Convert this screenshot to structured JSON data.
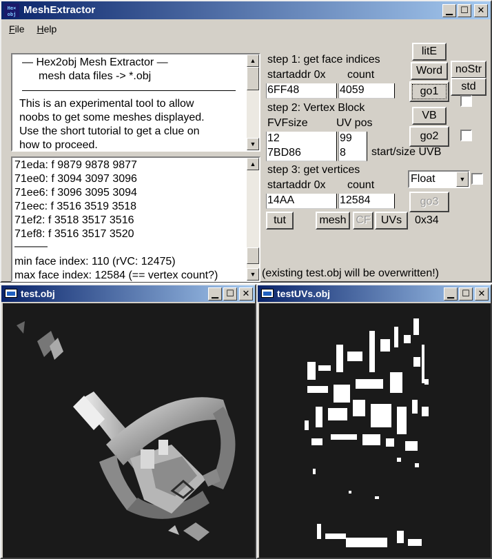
{
  "main_window": {
    "title": "MeshExtractor",
    "app_icon_text": "Hex\nobj",
    "menu": [
      {
        "label": "File",
        "accel": "F"
      },
      {
        "label": "Help",
        "accel": "H"
      }
    ]
  },
  "info_box": {
    "heading1": "—   Hex2obj Mesh Extractor   —",
    "heading2": "mesh data files -> *.obj",
    "body": [
      "This is an experimental tool to allow",
      "noobs to get some meshes displayed.",
      "Use the short tutorial to get a clue on",
      "how to proceed."
    ]
  },
  "log_box": {
    "lines": [
      "71eda: f  9879 9878 9877",
      "71ee0: f  3094 3097 3096",
      "71ee6: f  3096 3095 3094",
      "71eec: f  3516 3519 3518",
      "71ef2: f  3518 3517 3516",
      "71ef8: f  3516 3517 3520"
    ],
    "separator": "———",
    "min_line": "min face index: 110  (rVC: 12475)",
    "max_line": "max face index: 12584 (== vertex count?)"
  },
  "step1": {
    "title": "step 1: get face indices",
    "startaddr_label": "startaddr 0x",
    "count_label": "count",
    "startaddr_value": "6FF48",
    "count_value": "4059"
  },
  "step2": {
    "title": "step 2: Vertex Block",
    "fvf_label": "FVFsize",
    "uvpos_label": "UV pos",
    "fvf_value": "12",
    "uvpos_value": "99",
    "uvb_start_value": "7BD86",
    "uvb_size_value": "8",
    "uvb_label": "start/size UVB"
  },
  "step3": {
    "title": "step 3: get vertices",
    "startaddr_label": "startaddr 0x",
    "count_label": "count",
    "startaddr_value": "14AA",
    "count_value": "12584",
    "type_selected": "Float"
  },
  "buttons": {
    "lite": "litE",
    "word": "Word",
    "nostr": "noStr",
    "std": "std",
    "go1": "go1",
    "vb": "VB",
    "go2": "go2",
    "go3": "go3",
    "tut": "tut",
    "mesh": "mesh",
    "cf": "CF",
    "uvs": "UVs",
    "hex": "0x34"
  },
  "overwrite_note": "(existing test.obj will be overwritten!)",
  "obj_window": {
    "title": "test.obj"
  },
  "uv_window": {
    "title": "testUVs.obj"
  },
  "colors": {
    "title_start": "#0a246a",
    "title_end": "#a6caf0",
    "face": "#d4d0c8",
    "canvas_bg": "#1a1a1a"
  }
}
